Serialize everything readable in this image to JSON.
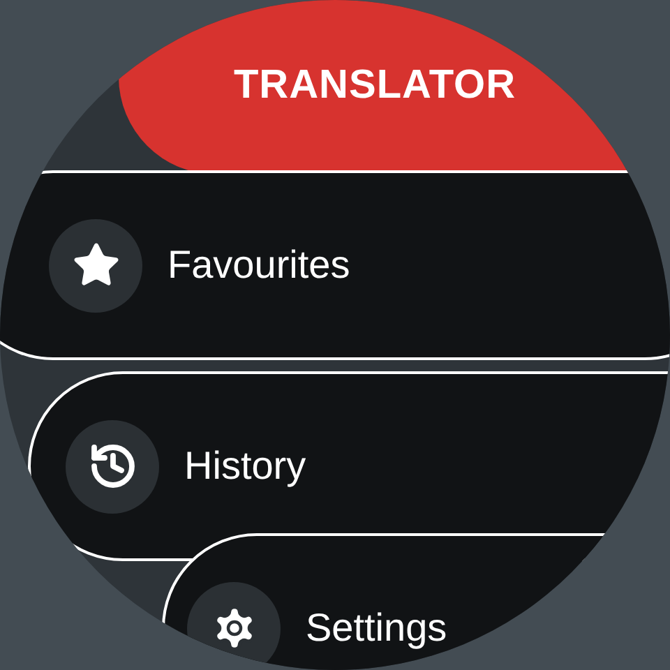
{
  "header": {
    "title": "TRANSLATOR"
  },
  "menu": [
    {
      "label": "Favourites"
    },
    {
      "label": "History"
    },
    {
      "label": "Settings"
    }
  ]
}
